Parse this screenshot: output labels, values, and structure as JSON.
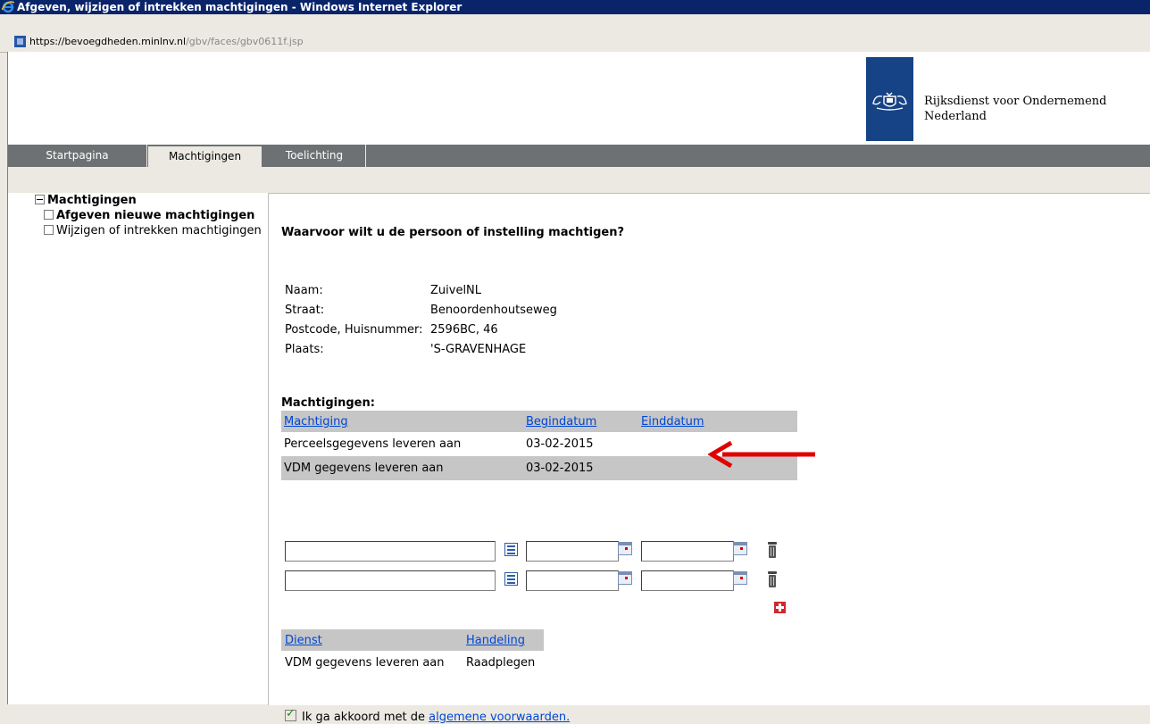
{
  "window": {
    "title": "Afgeven, wijzigen of intrekken machtigingen - Windows Internet Explorer",
    "icon": "ie-logo-icon"
  },
  "address": {
    "host": "https://bevoegdheden.minlnv.nl",
    "path": "/gbv/faces/gbv0611f.jsp"
  },
  "header": {
    "org_line1": "Rijksdienst voor Ondernemend",
    "org_line2": "Nederland",
    "brand_color": "#164385"
  },
  "nav": {
    "tabs": [
      {
        "label": "Startpagina",
        "active": false
      },
      {
        "label": "Machtigingen",
        "active": true
      },
      {
        "label": "Toelichting",
        "active": false
      }
    ]
  },
  "sidebar": {
    "root": "Machtigingen",
    "items": [
      {
        "label": "Afgeven nieuwe machtigingen",
        "bold": true
      },
      {
        "label": "Wijzigen of intrekken machtigingen",
        "bold": false
      }
    ]
  },
  "main": {
    "question": "Waarvoor wilt u de persoon of instelling machtigen?",
    "info": [
      {
        "label": "Naam:",
        "value": "ZuivelNL"
      },
      {
        "label": "Straat:",
        "value": "Benoordenhoutseweg"
      },
      {
        "label": "Postcode, Huisnummer:",
        "value": "2596BC, 46"
      },
      {
        "label": "Plaats:",
        "value": "'S-GRAVENHAGE"
      }
    ],
    "machtigingen_title": "Machtigingen:",
    "columns": {
      "machtiging": "Machtiging",
      "begindatum": "Begindatum",
      "einddatum": "Einddatum"
    },
    "rows": [
      {
        "machtiging": "Perceelsgegevens leveren aan",
        "begindatum": "03-02-2015",
        "einddatum": ""
      },
      {
        "machtiging": "VDM gegevens leveren aan",
        "begindatum": "03-02-2015",
        "einddatum": ""
      }
    ],
    "input_rows": [
      {
        "machtiging": "",
        "begindatum": "",
        "einddatum": ""
      },
      {
        "machtiging": "",
        "begindatum": "",
        "einddatum": ""
      }
    ],
    "dienst_columns": {
      "dienst": "Dienst",
      "handeling": "Handeling"
    },
    "dienst_rows": [
      {
        "dienst": "VDM gegevens leveren aan",
        "handeling": "Raadplegen"
      }
    ],
    "agree_text": "Ik ga akkoord met de",
    "agree_link": "algemene voorwaarden.",
    "agree_checked": true,
    "annotation_color": "#e00000"
  }
}
